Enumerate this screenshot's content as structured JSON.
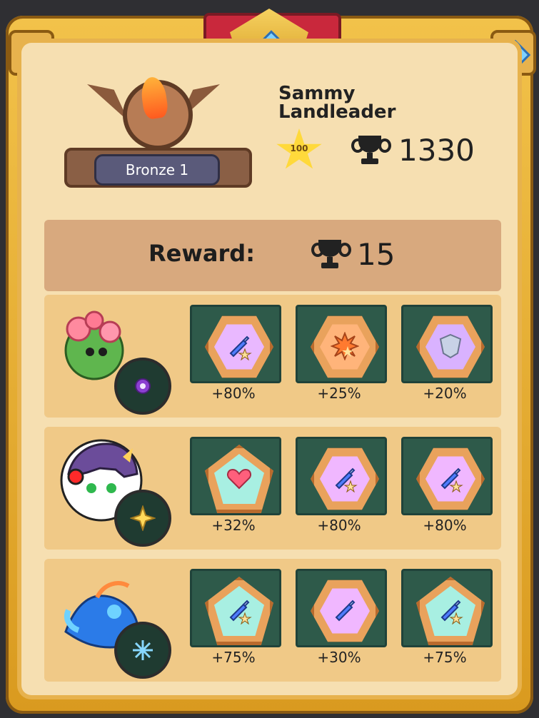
{
  "player": {
    "name_line1": "Sammy",
    "name_line2": "Landleader",
    "level": "100",
    "trophies": "1330",
    "rank": "Bronze 1"
  },
  "reward": {
    "label": "Reward:",
    "value": "15"
  },
  "rows": [
    {
      "avatar_icon": "flower-cactus-creature",
      "element_icon": "purple-eye-icon",
      "slots": [
        {
          "icon": "sword-star-icon",
          "shape": "hex",
          "color": "#e9b8ff",
          "value": "+80%"
        },
        {
          "icon": "explosion-icon",
          "shape": "hex",
          "color": "#ffb47a",
          "value": "+25%"
        },
        {
          "icon": "shield-icon",
          "shape": "hex",
          "color": "#d9b2ff",
          "value": "+20%"
        }
      ]
    },
    {
      "avatar_icon": "helmet-hero",
      "element_icon": "light-star-icon",
      "slots": [
        {
          "icon": "heart-icon",
          "shape": "pent",
          "color": "#a8efe2",
          "value": "+32%"
        },
        {
          "icon": "sword-star-icon",
          "shape": "hex",
          "color": "#f0b7ff",
          "value": "+80%"
        },
        {
          "icon": "sword-star-icon",
          "shape": "hex",
          "color": "#f0b7ff",
          "value": "+80%"
        }
      ]
    },
    {
      "avatar_icon": "water-dragon",
      "element_icon": "snowflake-icon",
      "slots": [
        {
          "icon": "sword-star-icon",
          "shape": "pent",
          "color": "#a8efe2",
          "value": "+75%"
        },
        {
          "icon": "sword-icon",
          "shape": "hex",
          "color": "#f0b7ff",
          "value": "+30%"
        },
        {
          "icon": "sword-star-icon",
          "shape": "pent",
          "color": "#a8efe2",
          "value": "+75%"
        }
      ]
    }
  ]
}
